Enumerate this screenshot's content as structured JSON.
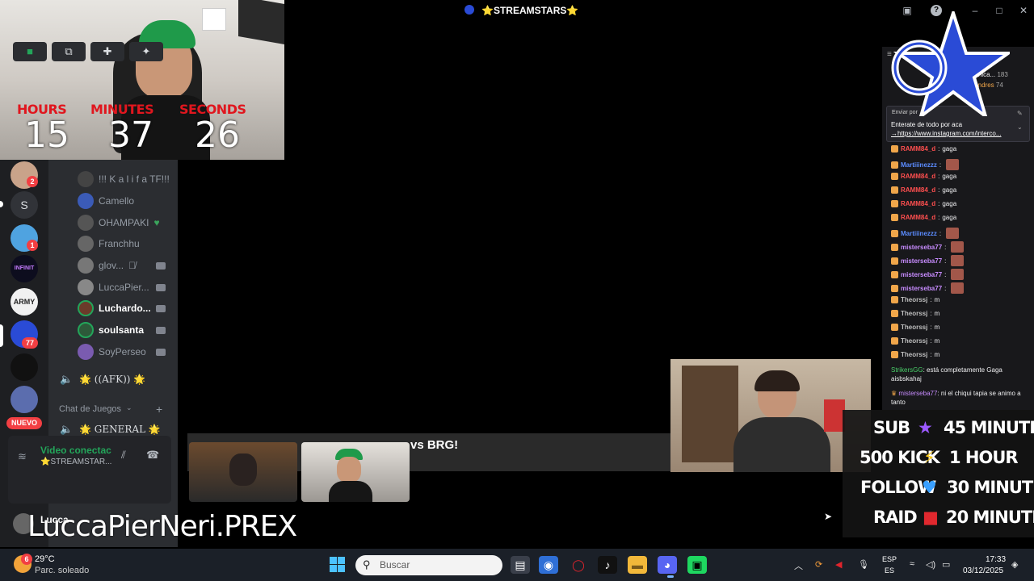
{
  "window": {
    "title": "⭐STREAMSTARS⭐"
  },
  "timer": {
    "hours_label": "HOURS",
    "minutes_label": "MINUTES",
    "seconds_label": "SECONDS",
    "hours": "15",
    "minutes": "37",
    "seconds": "26"
  },
  "rail": {
    "badges": [
      "2",
      "1",
      "77"
    ],
    "letter": "S",
    "infinit": "INFINIT",
    "army": "ARMY",
    "new_label": "NUEVO"
  },
  "channel": {
    "users": [
      "!!! K a l i f a TF!!!",
      "Camello",
      "OHAMPAKI",
      "Franchhu",
      "glov...",
      "LuccaPier...",
      "Luchardo...",
      "soulsanta",
      "SoyPerseo"
    ],
    "afk": "🌟 ((AFK)) 🌟",
    "category": "Chat de Juegos",
    "general": "🌟 GENERAL 🌟"
  },
  "voice": {
    "status": "Video conectac",
    "server": "⭐STREAMSTAR..."
  },
  "user_panel": {
    "name": "Lucca"
  },
  "streamer_name": "LuccaPierNeri.PREX",
  "match_banner": "vs BRG!",
  "chat": {
    "top_users": [
      {
        "name": "..anica...",
        "count": "183"
      },
      {
        "name": "Oandres",
        "count": "74"
      }
    ],
    "pinned_by": "Enviar por",
    "pinned_text": "Enterate de todo por aca",
    "pinned_link": "→https://www.instagram.com/interco...",
    "messages": [
      {
        "user": "RAMM84_d",
        "text": "gaga",
        "color": "#ff4f4f"
      },
      {
        "user": "Martiiinezzz",
        "text": "",
        "color": "#5b8cff"
      },
      {
        "user": "RAMM84_d",
        "text": "gaga",
        "color": "#ff4f4f"
      },
      {
        "user": "RAMM84_d",
        "text": "gaga",
        "color": "#ff4f4f"
      },
      {
        "user": "RAMM84_d",
        "text": "gaga",
        "color": "#ff4f4f"
      },
      {
        "user": "RAMM84_d",
        "text": "gaga",
        "color": "#ff4f4f"
      },
      {
        "user": "Martiiinezzz",
        "text": "",
        "color": "#5b8cff"
      },
      {
        "user": "misterseba77",
        "text": "",
        "color": "#c88cff"
      },
      {
        "user": "misterseba77",
        "text": "",
        "color": "#c88cff"
      },
      {
        "user": "misterseba77",
        "text": "",
        "color": "#c88cff"
      },
      {
        "user": "misterseba77",
        "text": "",
        "color": "#c88cff"
      },
      {
        "user": "Theorssj",
        "text": "m",
        "color": "#bfbfbf"
      },
      {
        "user": "Theorssj",
        "text": "m",
        "color": "#bfbfbf"
      },
      {
        "user": "Theorssj",
        "text": "m",
        "color": "#bfbfbf"
      },
      {
        "user": "Theorssj",
        "text": "m",
        "color": "#bfbfbf"
      },
      {
        "user": "Theorssj",
        "text": "m",
        "color": "#bfbfbf"
      }
    ],
    "long1_user": "StrikersGG",
    "long1_text": "está completamente Gaga aisbskahaj",
    "long2_user": "misterseba77",
    "long2_text": "ni el chiqui tapia se animo a tanto"
  },
  "overlay": {
    "rows": [
      {
        "label": "SUB",
        "icon": "★",
        "icon_color": "#9b59ff",
        "time": "45 MINUTES"
      },
      {
        "label": "500 KICK",
        "icon": "⚡",
        "icon_color": "#f5c518",
        "time": "1 HOUR"
      },
      {
        "label": "FOLLOW",
        "icon": "♥",
        "icon_color": "#3aa0ff",
        "time": "30 MINUTES"
      },
      {
        "label": "RAID",
        "icon": "■",
        "icon_color": "#e0282e",
        "time": "20 MINUTES"
      }
    ]
  },
  "taskbar": {
    "weather_temp": "29°C",
    "weather_desc": "Parc. soleado",
    "weather_badge": "6",
    "search_placeholder": "Buscar",
    "lang1": "ESP",
    "lang2": "ES",
    "time": "17:33",
    "date": "03/12/2025"
  }
}
